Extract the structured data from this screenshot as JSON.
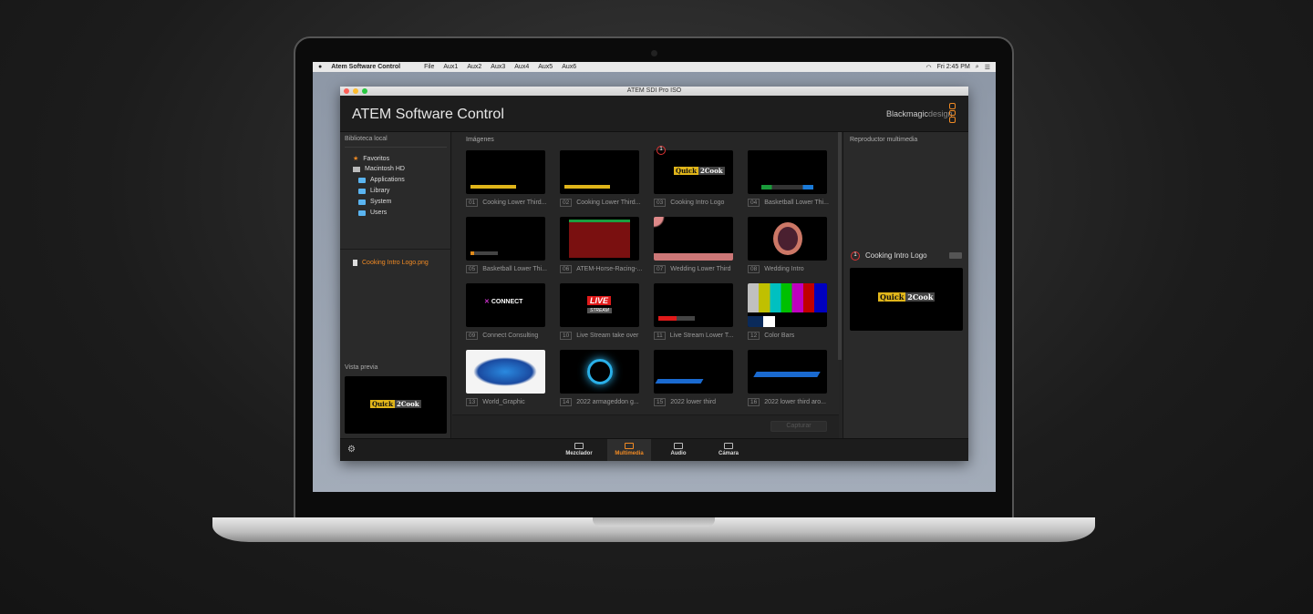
{
  "menubar": {
    "app": "Atem Software Control",
    "items": [
      "File",
      "Aux1",
      "Aux2",
      "Aux3",
      "Aux4",
      "Aux5",
      "Aux6"
    ],
    "clock": "Fri 2:45 PM"
  },
  "window": {
    "title": "ATEM SDI Pro ISO",
    "app_title": "ATEM Software Control",
    "brand_main": "Blackmagic",
    "brand_sub": "design"
  },
  "left": {
    "heading": "Biblioteca local",
    "tree": [
      {
        "label": "Favoritos",
        "icon": "star-icon"
      },
      {
        "label": "Macintosh HD",
        "icon": "drive-icon"
      },
      {
        "label": "Applications",
        "icon": "folder-icon"
      },
      {
        "label": "Library",
        "icon": "folder-icon"
      },
      {
        "label": "System",
        "icon": "folder-icon"
      },
      {
        "label": "Users",
        "icon": "folder-icon"
      }
    ],
    "file": "Cooking Intro Logo.png",
    "preview_heading": "Vista previa"
  },
  "center": {
    "heading": "Imágenes",
    "capture_label": "Capturar",
    "items": [
      {
        "num": "01",
        "name": "Cooking Lower Third..."
      },
      {
        "num": "02",
        "name": "Cooking Lower Third..."
      },
      {
        "num": "03",
        "name": "Cooking Intro Logo"
      },
      {
        "num": "04",
        "name": "Basketball Lower Thi..."
      },
      {
        "num": "05",
        "name": "Basketball Lower Thi..."
      },
      {
        "num": "06",
        "name": "ATEM-Horse-Racing-..."
      },
      {
        "num": "07",
        "name": "Wedding Lower Third"
      },
      {
        "num": "08",
        "name": "Wedding Intro"
      },
      {
        "num": "09",
        "name": "Connect Consulting"
      },
      {
        "num": "10",
        "name": "Live Stream take over"
      },
      {
        "num": "11",
        "name": "Live Stream Lower T..."
      },
      {
        "num": "12",
        "name": "Color Bars"
      },
      {
        "num": "13",
        "name": "World_Graphic"
      },
      {
        "num": "14",
        "name": "2022 armageddon g..."
      },
      {
        "num": "15",
        "name": "2022 lower third"
      },
      {
        "num": "16",
        "name": "2022 lower third aro..."
      }
    ],
    "badge": "1",
    "thumb_text": {
      "q2c_a": "Quick",
      "q2c_b": "2Cook",
      "connect": "CONNECT",
      "live": "LIVE",
      "stream": "STREAM"
    }
  },
  "right": {
    "heading": "Reproductor multimedia",
    "player": {
      "badge": "1",
      "name": "Cooking Intro Logo"
    }
  },
  "bottom": {
    "tabs": [
      {
        "label": "Mezclador",
        "icon": "mixer-icon"
      },
      {
        "label": "Multimedia",
        "icon": "media-icon",
        "active": true
      },
      {
        "label": "Audio",
        "icon": "audio-icon"
      },
      {
        "label": "Cámara",
        "icon": "camera-icon"
      }
    ]
  },
  "colors": {
    "accent": "#f08a24",
    "badge": "#d33333",
    "folder": "#5ab4f0"
  }
}
